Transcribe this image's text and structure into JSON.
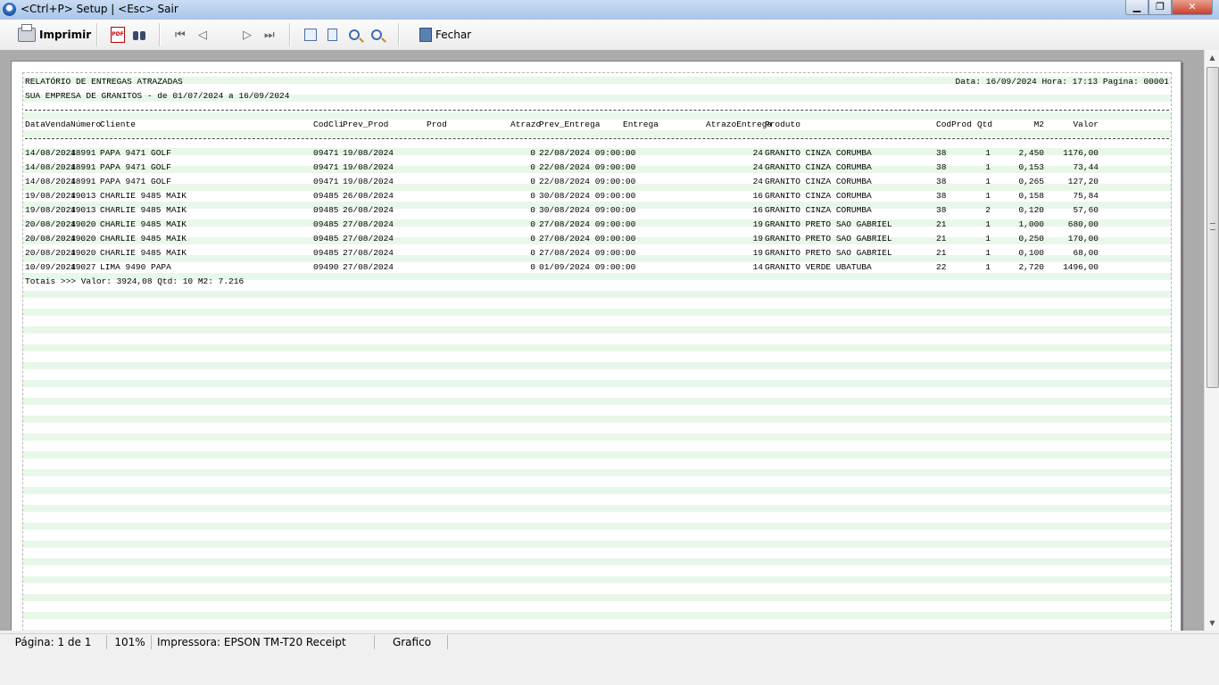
{
  "window": {
    "title": "<Ctrl+P> Setup | <Esc> Sair"
  },
  "toolbar": {
    "print_label": "Imprimir",
    "close_label": "Fechar"
  },
  "report": {
    "title": "RELATÓRIO DE ENTREGAS ATRAZADAS",
    "subtitle": "SUA EMPRESA DE GRANITOS - de 01/07/2024 a 16/09/2024",
    "header_right": "Data: 16/09/2024 Hora: 17:13 Pagina: 00001",
    "columns": {
      "datavenda": "DataVenda",
      "numero": "Número",
      "cliente": "Cliente",
      "codcli": "CodCli",
      "prev_prod": "Prev_Prod",
      "prod": "Prod",
      "atrazo": "Atrazo",
      "prev_entrega": "Prev_Entrega",
      "entrega": "Entrega",
      "atrazo_entrega": "AtrazoEntrega",
      "produto": "Produto",
      "codprod": "CodProd",
      "qtd": "Qtd",
      "m2": "M2",
      "valor": "Valor"
    },
    "rows": [
      {
        "datavenda": "14/08/2024",
        "numero": "18991",
        "cliente": "PAPA 9471 GOLF",
        "codcli": "09471",
        "prev_prod": "19/08/2024",
        "atrazo": "0",
        "prev_entrega": "22/08/2024 09:00:00",
        "atrazo_entrega": "24",
        "produto": "GRANITO CINZA CORUMBA",
        "codprod": "38",
        "qtd": "1",
        "m2": "2,450",
        "valor": "1176,00"
      },
      {
        "datavenda": "14/08/2024",
        "numero": "18991",
        "cliente": "PAPA 9471 GOLF",
        "codcli": "09471",
        "prev_prod": "19/08/2024",
        "atrazo": "0",
        "prev_entrega": "22/08/2024 09:00:00",
        "atrazo_entrega": "24",
        "produto": "GRANITO CINZA CORUMBA",
        "codprod": "38",
        "qtd": "1",
        "m2": "0,153",
        "valor": "73,44"
      },
      {
        "datavenda": "14/08/2024",
        "numero": "18991",
        "cliente": "PAPA 9471 GOLF",
        "codcli": "09471",
        "prev_prod": "19/08/2024",
        "atrazo": "0",
        "prev_entrega": "22/08/2024 09:00:00",
        "atrazo_entrega": "24",
        "produto": "GRANITO CINZA CORUMBA",
        "codprod": "38",
        "qtd": "1",
        "m2": "0,265",
        "valor": "127,20"
      },
      {
        "datavenda": "19/08/2024",
        "numero": "19013",
        "cliente": "CHARLIE 9485 MAIK",
        "codcli": "09485",
        "prev_prod": "26/08/2024",
        "atrazo": "0",
        "prev_entrega": "30/08/2024 09:00:00",
        "atrazo_entrega": "16",
        "produto": "GRANITO CINZA CORUMBA",
        "codprod": "38",
        "qtd": "1",
        "m2": "0,158",
        "valor": "75,84"
      },
      {
        "datavenda": "19/08/2024",
        "numero": "19013",
        "cliente": "CHARLIE 9485 MAIK",
        "codcli": "09485",
        "prev_prod": "26/08/2024",
        "atrazo": "0",
        "prev_entrega": "30/08/2024 09:00:00",
        "atrazo_entrega": "16",
        "produto": "GRANITO CINZA CORUMBA",
        "codprod": "38",
        "qtd": "2",
        "m2": "0,120",
        "valor": "57,60"
      },
      {
        "datavenda": "20/08/2024",
        "numero": "19020",
        "cliente": "CHARLIE 9485 MAIK",
        "codcli": "09485",
        "prev_prod": "27/08/2024",
        "atrazo": "0",
        "prev_entrega": "27/08/2024 09:00:00",
        "atrazo_entrega": "19",
        "produto": "GRANITO PRETO SAO GABRIEL",
        "codprod": "21",
        "qtd": "1",
        "m2": "1,000",
        "valor": "680,00"
      },
      {
        "datavenda": "20/08/2024",
        "numero": "19020",
        "cliente": "CHARLIE 9485 MAIK",
        "codcli": "09485",
        "prev_prod": "27/08/2024",
        "atrazo": "0",
        "prev_entrega": "27/08/2024 09:00:00",
        "atrazo_entrega": "19",
        "produto": "GRANITO PRETO SAO GABRIEL",
        "codprod": "21",
        "qtd": "1",
        "m2": "0,250",
        "valor": "170,00"
      },
      {
        "datavenda": "20/08/2024",
        "numero": "19020",
        "cliente": "CHARLIE 9485 MAIK",
        "codcli": "09485",
        "prev_prod": "27/08/2024",
        "atrazo": "0",
        "prev_entrega": "27/08/2024 09:00:00",
        "atrazo_entrega": "19",
        "produto": "GRANITO PRETO SAO GABRIEL",
        "codprod": "21",
        "qtd": "1",
        "m2": "0,100",
        "valor": "68,00"
      },
      {
        "datavenda": "10/09/2024",
        "numero": "19027",
        "cliente": "LIMA 9490 PAPA",
        "codcli": "09490",
        "prev_prod": "27/08/2024",
        "atrazo": "0",
        "prev_entrega": "01/09/2024 09:00:00",
        "atrazo_entrega": "14",
        "produto": "GRANITO VERDE UBATUBA",
        "codprod": "22",
        "qtd": "1",
        "m2": "2,720",
        "valor": "1496,00"
      }
    ],
    "totals": "Totais >>> Valor: 3924,08 Qtd: 10 M2: 7.216"
  },
  "status": {
    "page": "Página: 1 de 1",
    "zoom": "101%",
    "printer": "Impressora: EPSON TM-T20 Receipt",
    "mode": "Grafico"
  }
}
